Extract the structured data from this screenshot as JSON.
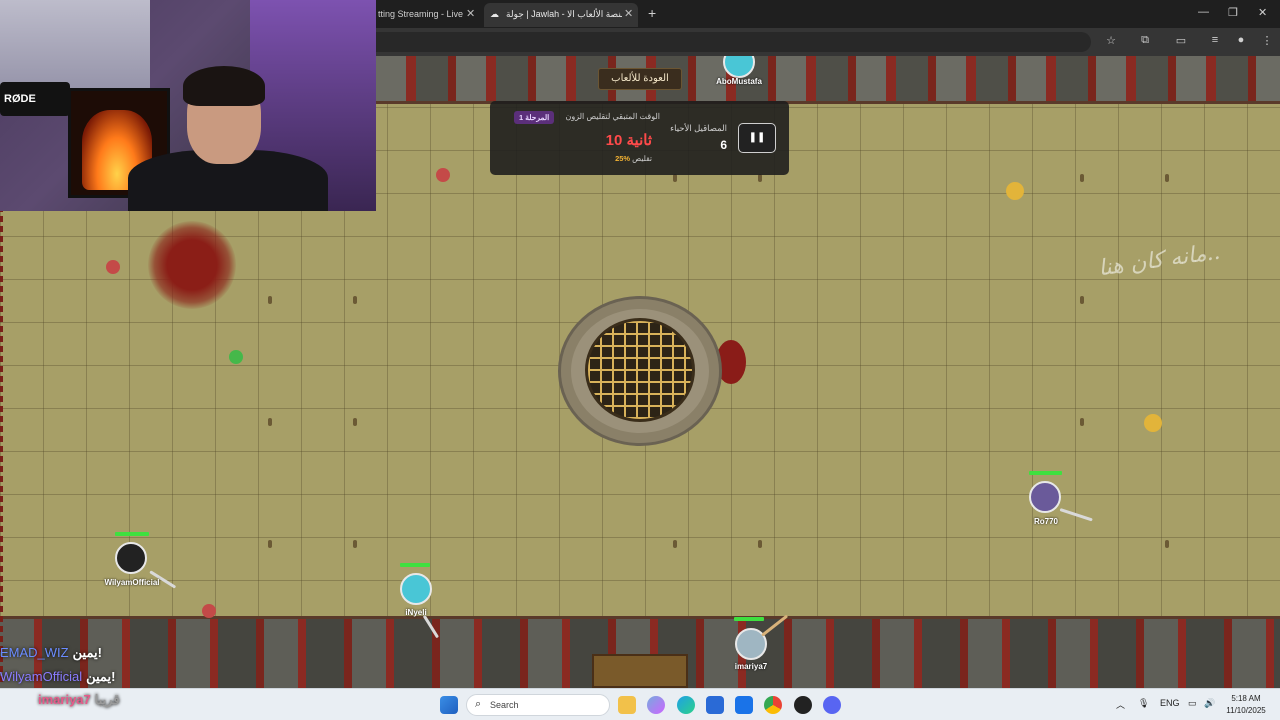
{
  "browser": {
    "tabs": [
      {
        "label": "tting Streaming - Live",
        "active": false
      },
      {
        "label": "جولة | Jawlah - منصة الألعاب الا",
        "active": true
      }
    ],
    "new_tab": "+",
    "window_controls": {
      "minimize": "—",
      "maximize": "❐",
      "close": "✕"
    }
  },
  "hud": {
    "back_button": "العودة للألعاب",
    "alive_label": "المصاقيل الأحياء",
    "alive_count": "6",
    "shrink_label": "الوقت المتبقي لتقليص الزون",
    "stage_badge": "المرحلة 1",
    "timer": "10 ثانية",
    "shrink_percent": "25%",
    "shrink_word": "تقليص",
    "pause_icon": "❚❚"
  },
  "players": [
    {
      "name": "AboMustafa",
      "color": "#49c6d6"
    },
    {
      "name": "WilyamOfficial",
      "color": "#222222"
    },
    {
      "name": "iNyeli",
      "color": "#49c6d6"
    },
    {
      "name": "imariya7",
      "color": "#9fb6c2"
    },
    {
      "name": "Ro770",
      "color": "#6a5a9a"
    }
  ],
  "ghost_writing": "مانه كان هنا..",
  "cam": {
    "mic_brand": "RØDE"
  },
  "chat": [
    {
      "user": "EMAD_WIZ",
      "user_color": "#6b8cff",
      "message": "يمين!"
    },
    {
      "user": "WilyamOfficial",
      "user_color": "#8a7cff",
      "message": "يمين!"
    },
    {
      "user": "imariya7",
      "user_color": "#e85a8a",
      "message": "قريبا"
    }
  ],
  "taskbar": {
    "search_placeholder": "Search",
    "language": "ENG",
    "time": "5:18 AM",
    "date": "11/10/2025"
  },
  "colors": {
    "floor": "#a79f67",
    "hud_bg": "#1c1c1c",
    "timer": "#ff4a4a",
    "stage_badge": "#5b2f7a",
    "hp": "#3fe03f"
  }
}
